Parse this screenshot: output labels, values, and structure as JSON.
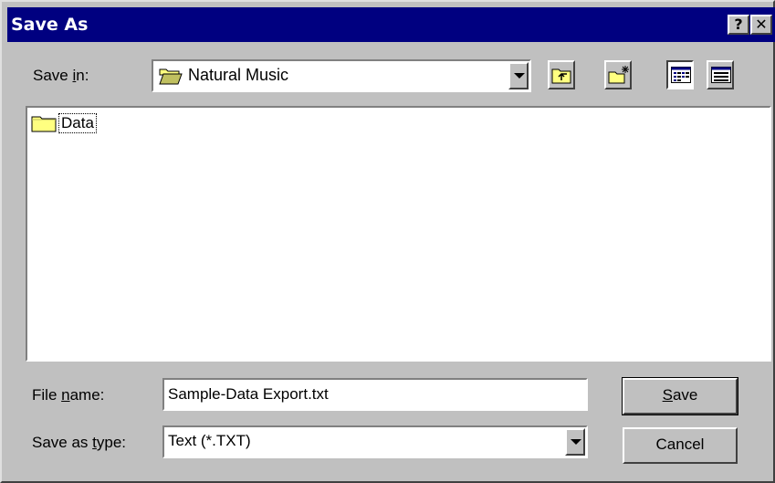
{
  "window": {
    "title": "Save As",
    "help_label": "?",
    "close_label": "✕"
  },
  "save_in": {
    "label_pre": "Save ",
    "label_key": "i",
    "label_post": "n:",
    "value": "Natural Music"
  },
  "toolbar": {
    "icons": [
      "up-one-level-icon",
      "create-new-folder-icon",
      "list-view-icon",
      "details-view-icon"
    ]
  },
  "file_list": {
    "items": [
      {
        "name": "Data",
        "icon": "folder-icon"
      }
    ]
  },
  "file_name": {
    "label_pre": "File ",
    "label_key": "n",
    "label_post": "ame:",
    "value": "Sample-Data Export.txt"
  },
  "save_as_type": {
    "label_pre": "Save as ",
    "label_key": "t",
    "label_post": "ype:",
    "value": "Text (*.TXT)"
  },
  "buttons": {
    "save_key": "S",
    "save_rest": "ave",
    "cancel": "Cancel"
  },
  "colors": {
    "titlebar": "#000080",
    "face": "#c0c0c0",
    "folder": "#ffff80"
  }
}
